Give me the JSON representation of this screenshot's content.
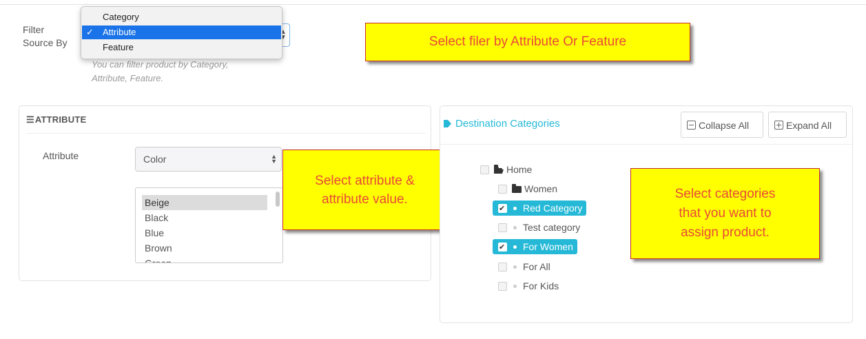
{
  "filter": {
    "label_line1": "Filter",
    "label_line2": "Source By",
    "options": [
      "Category",
      "Attribute",
      "Feature"
    ],
    "selected": "Attribute",
    "check_mark": "✓",
    "help_line1": "You can filter product by Category,",
    "help_line2": "Attribute, Feature."
  },
  "notes": {
    "filter": "Select filer by Attribute Or Feature",
    "attribute_line1": "Select attribute &",
    "attribute_line2": "attribute value.",
    "categories_line1": "Select categories",
    "categories_line2": "that you want to",
    "categories_line3": "assign product."
  },
  "attribute_panel": {
    "title": "ATTRIBUTE",
    "label": "Attribute",
    "selected": "Color",
    "values": [
      "Beige",
      "Black",
      "Blue",
      "Brown",
      "Green"
    ],
    "selected_value": "Beige"
  },
  "destination": {
    "title": "Destination Categories",
    "collapse_label": "Collapse All",
    "expand_label": "Expand All",
    "tree": [
      {
        "label": "Home",
        "checked": false
      },
      {
        "label": "Women",
        "checked": false
      },
      {
        "label": "Red Category",
        "checked": true
      },
      {
        "label": "Test category",
        "checked": false
      },
      {
        "label": "For Women",
        "checked": true
      },
      {
        "label": "For All",
        "checked": false
      },
      {
        "label": "For Kids",
        "checked": false
      }
    ]
  },
  "colors": {
    "accent": "#25b9d7",
    "note_bg": "#ffff00",
    "note_text": "#e8493a",
    "menu_selected": "#1a73e8"
  }
}
